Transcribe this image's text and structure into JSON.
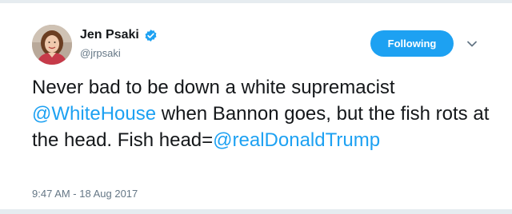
{
  "user": {
    "display_name": "Jen Psaki",
    "handle": "@jrpsaki",
    "verified": true,
    "avatar_icon": "user-avatar-photo"
  },
  "follow_button": {
    "label": "Following",
    "color": "#1da1f2"
  },
  "more_menu": {
    "icon": "chevron-down-icon"
  },
  "tweet": {
    "segments": [
      "Never bad to be down a white supremacist ",
      "@WhiteHouse",
      " when Bannon goes, but the fish rots at the head. Fish head=",
      "@realDonaldTrump"
    ],
    "mentions": [
      "@WhiteHouse",
      "@realDonaldTrump"
    ],
    "link_color": "#1da1f2"
  },
  "timestamp": "9:47 AM - 18 Aug 2017"
}
